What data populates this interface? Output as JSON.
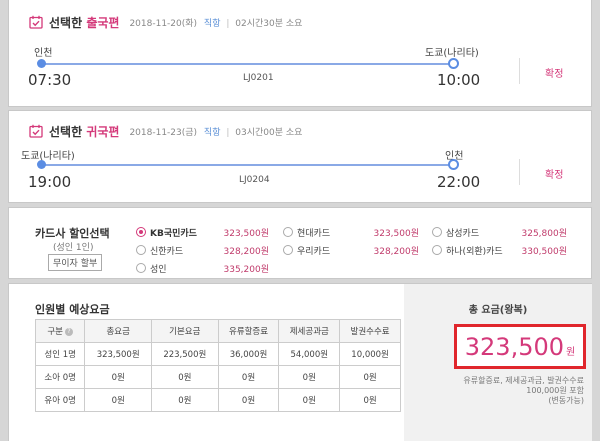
{
  "outbound": {
    "title_prefix": "선택한 ",
    "title_accent": "출국편",
    "date": "2018-11-20(화)",
    "direct": "직항",
    "separator": "|",
    "duration": "02시간30분 소요",
    "from_city": "인천",
    "to_city": "도쿄(나리타)",
    "depart_time": "07:30",
    "arrive_time": "10:00",
    "flight_no": "LJ0201",
    "confirm": "확정"
  },
  "inbound": {
    "title_prefix": "선택한 ",
    "title_accent": "귀국편",
    "date": "2018-11-23(금)",
    "direct": "직항",
    "separator": "|",
    "duration": "03시간00분 소요",
    "from_city": "도쿄(나리타)",
    "to_city": "인천",
    "depart_time": "19:00",
    "arrive_time": "22:00",
    "flight_no": "LJ0204",
    "confirm": "확정"
  },
  "card": {
    "title": "카드사 할인선택",
    "subtitle": "(성인 1인)",
    "no_interest": "무이자 할부",
    "options": [
      {
        "name": "KB국민카드",
        "price": "323,500원",
        "selected": true
      },
      {
        "name": "현대카드",
        "price": "323,500원",
        "selected": false
      },
      {
        "name": "삼성카드",
        "price": "325,800원",
        "selected": false
      },
      {
        "name": "신한카드",
        "price": "328,200원",
        "selected": false
      },
      {
        "name": "우리카드",
        "price": "328,200원",
        "selected": false
      },
      {
        "name": "하나(외환)카드",
        "price": "330,500원",
        "selected": false
      },
      {
        "name": "성인",
        "price": "335,200원",
        "selected": false
      }
    ]
  },
  "fare": {
    "title": "인원별 예상요금",
    "columns": [
      "구분",
      "총요금",
      "기본요금",
      "유류할증료",
      "제세공과금",
      "발권수수료"
    ],
    "rows": [
      [
        "성인 1명",
        "323,500원",
        "223,500원",
        "36,000원",
        "54,000원",
        "10,000원"
      ],
      [
        "소아 0명",
        "0원",
        "0원",
        "0원",
        "0원",
        "0원"
      ],
      [
        "유아 0명",
        "0원",
        "0원",
        "0원",
        "0원",
        "0원"
      ]
    ]
  },
  "total": {
    "label": "총 요금(왕복)",
    "amount": "323,500",
    "unit": "원",
    "note_line1": "유류할증료, 제세공과금, 발권수수료",
    "note_line2": "100,000원 포함",
    "note_line3": "(변동가능)"
  },
  "colors": {
    "accent": "#d4397a",
    "route": "#5b8de3",
    "highlight_box": "#e0262c"
  }
}
